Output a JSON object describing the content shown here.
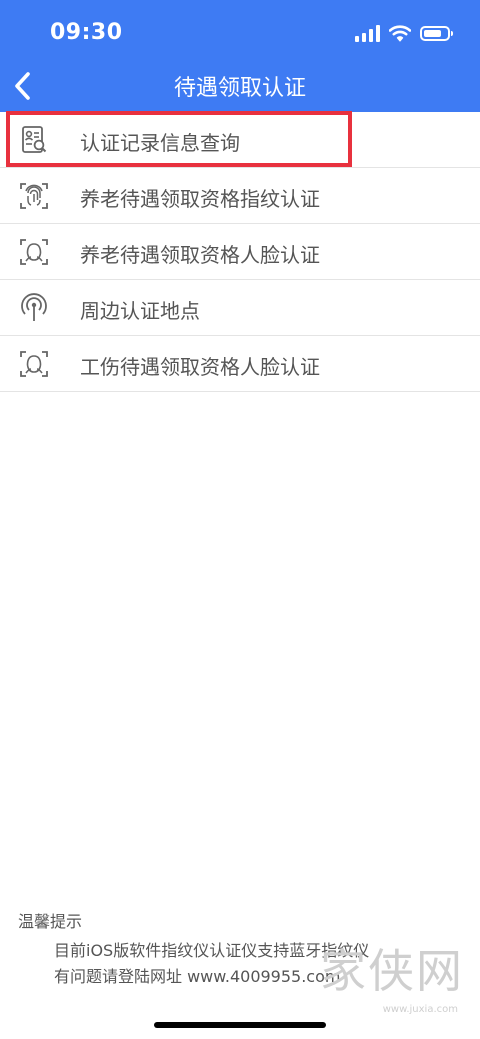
{
  "status_bar": {
    "time": "09:30"
  },
  "nav": {
    "title": "待遇领取认证"
  },
  "menu": {
    "items": [
      {
        "label": "认证记录信息查询",
        "icon": "record-search-icon"
      },
      {
        "label": "养老待遇领取资格指纹认证",
        "icon": "fingerprint-icon"
      },
      {
        "label": "养老待遇领取资格人脸认证",
        "icon": "face-scan-icon"
      },
      {
        "label": "周边认证地点",
        "icon": "location-signal-icon"
      },
      {
        "label": "工伤待遇领取资格人脸认证",
        "icon": "face-scan-icon"
      }
    ]
  },
  "tips": {
    "title": "温馨提示",
    "lines": [
      "目前iOS版软件指纹仪认证仪支持蓝牙指纹仪",
      "有问题请登陆网址 www.4009955.com"
    ]
  },
  "watermark": {
    "text": "家侠网",
    "url": "www.juxia.com"
  },
  "colors": {
    "header": "#3e7bf3",
    "highlight": "#e8313e",
    "divider": "#e4e4e4"
  }
}
